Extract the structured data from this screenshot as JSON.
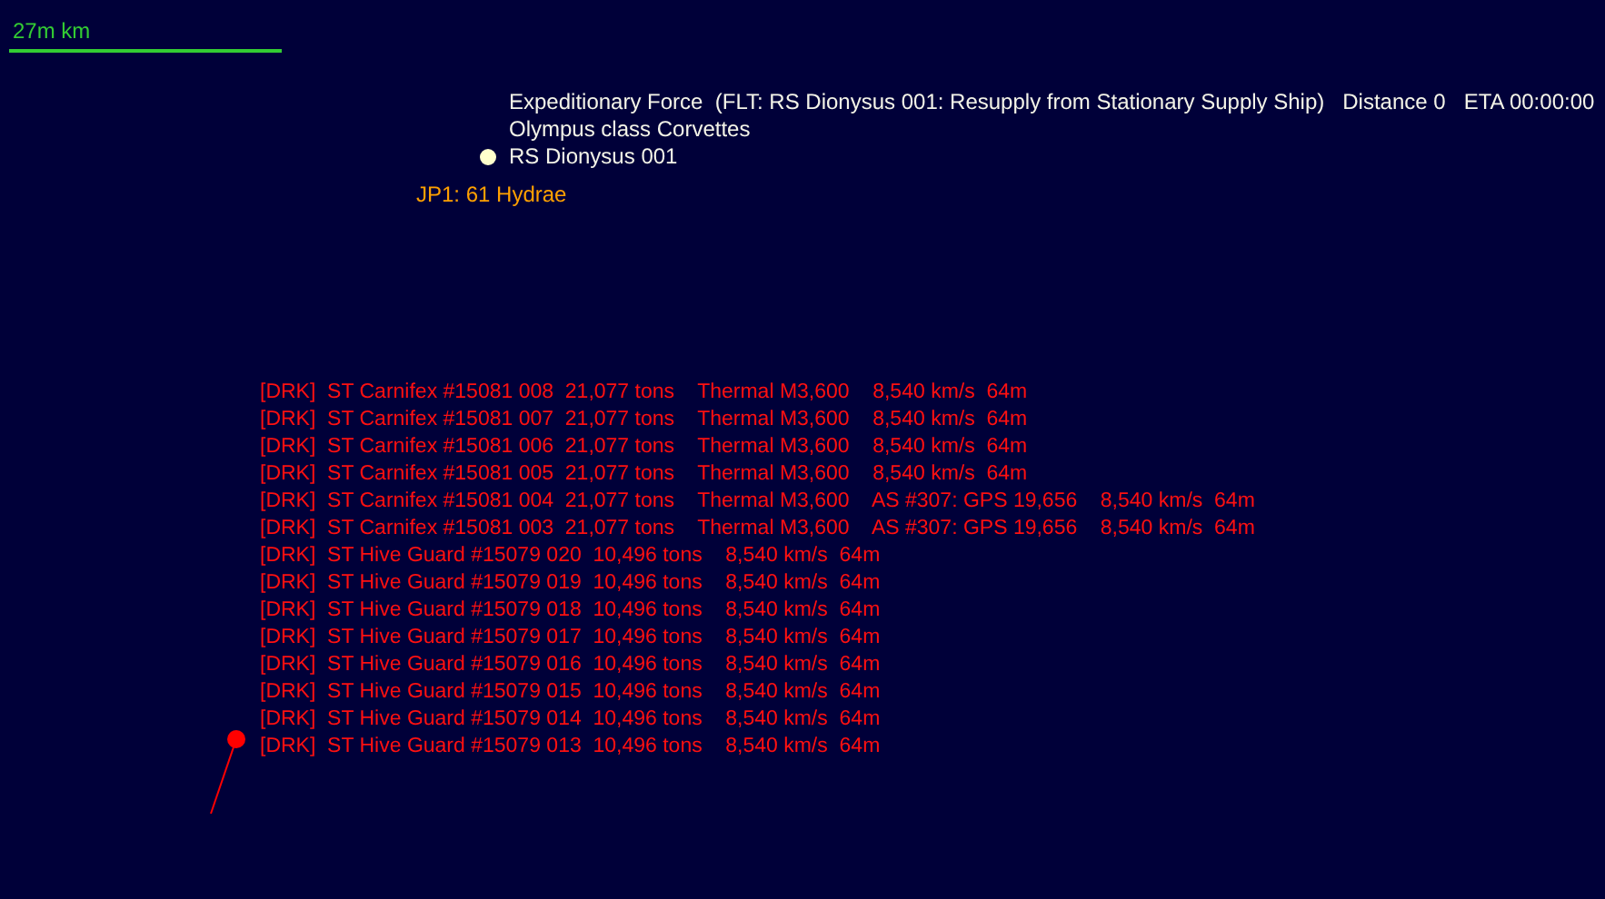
{
  "scale": {
    "label": "27m km"
  },
  "fleet": {
    "lines": [
      "Expeditionary Force  (FLT: RS Dionysus 001: Resupply from Stationary Supply Ship)   Distance 0   ETA 00:00:00",
      "Olympus class Corvettes"
    ],
    "ship": "RS Dionysus 001"
  },
  "jump_point": {
    "label": "JP1: 61 Hydrae"
  },
  "contacts": [
    {
      "text": "[DRK]  ST Carnifex #15081 008  21,077 tons    Thermal M3,600    8,540 km/s  64m"
    },
    {
      "text": "[DRK]  ST Carnifex #15081 007  21,077 tons    Thermal M3,600    8,540 km/s  64m"
    },
    {
      "text": "[DRK]  ST Carnifex #15081 006  21,077 tons    Thermal M3,600    8,540 km/s  64m"
    },
    {
      "text": "[DRK]  ST Carnifex #15081 005  21,077 tons    Thermal M3,600    8,540 km/s  64m"
    },
    {
      "text": "[DRK]  ST Carnifex #15081 004  21,077 tons    Thermal M3,600    AS #307: GPS 19,656    8,540 km/s  64m"
    },
    {
      "text": "[DRK]  ST Carnifex #15081 003  21,077 tons    Thermal M3,600    AS #307: GPS 19,656    8,540 km/s  64m"
    },
    {
      "text": "[DRK]  ST Hive Guard #15079 020  10,496 tons    8,540 km/s  64m"
    },
    {
      "text": "[DRK]  ST Hive Guard #15079 019  10,496 tons    8,540 km/s  64m"
    },
    {
      "text": "[DRK]  ST Hive Guard #15079 018  10,496 tons    8,540 km/s  64m"
    },
    {
      "text": "[DRK]  ST Hive Guard #15079 017  10,496 tons    8,540 km/s  64m"
    },
    {
      "text": "[DRK]  ST Hive Guard #15079 016  10,496 tons    8,540 km/s  64m"
    },
    {
      "text": "[DRK]  ST Hive Guard #15079 015  10,496 tons    8,540 km/s  64m"
    },
    {
      "text": "[DRK]  ST Hive Guard #15079 014  10,496 tons    8,540 km/s  64m"
    },
    {
      "text": "[DRK]  ST Hive Guard #15079 013  10,496 tons    8,540 km/s  64m"
    }
  ]
}
